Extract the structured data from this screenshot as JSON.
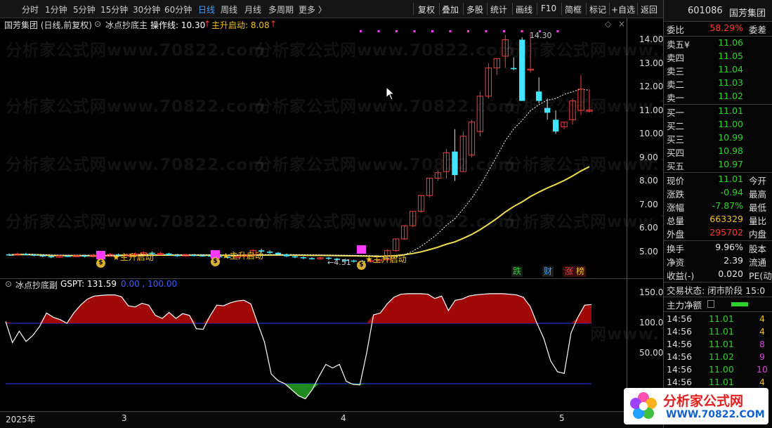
{
  "toolbar": {
    "periods": [
      "分时",
      "1分钟",
      "5分钟",
      "15分钟",
      "30分钟",
      "60分钟",
      "日线",
      "周线",
      "月线",
      "多周期",
      "更多 〉"
    ],
    "active_period": "日线",
    "tools": [
      "复权",
      "叠加",
      "多股",
      "统计",
      "画线",
      "F10",
      "简框",
      "标记",
      "+自选",
      "返回"
    ]
  },
  "main_chart": {
    "stock_title": "国芳集团 (日线,前复权)",
    "indicator_name": "冰点抄底主",
    "op_line_label": "操作线: 10.30",
    "op_line_arrow": "↑",
    "launch_label": "主升启动: 8.08",
    "launch_arrow": "↑",
    "signal_labels": [
      "主升启动",
      "主升启动",
      "主升启动"
    ],
    "high_label": "14.30",
    "low_label": "4.51",
    "y_ticks": [
      "14.00",
      "13.00",
      "12.00",
      "11.00",
      "10.00",
      "9.00",
      "8.00",
      "7.00",
      "6.00",
      "5.00"
    ],
    "money_bag_glyph": "$",
    "badges": [
      {
        "text": "跌",
        "color": "#2fd12f"
      },
      {
        "text": "财",
        "color": "#3fa0ff"
      },
      {
        "text": "涨",
        "color": "#ff3a3a"
      },
      {
        "text": "榜",
        "color": "#f0c020"
      }
    ],
    "colors": {
      "up": "#ff3a3a",
      "down": "#3fe6ff",
      "signal": "#ff3aff",
      "ma_slow": "#f0dd50",
      "ma_fast": "#ffffff"
    }
  },
  "chart_data": {
    "type": "candlestick",
    "y_axis": {
      "min": 4.0,
      "max": 15.0,
      "ticks": [
        14,
        13,
        12,
        11,
        10,
        9,
        8,
        7,
        6,
        5
      ]
    },
    "x_labels": [
      "2025年",
      "3",
      "4",
      "5"
    ],
    "candles": [
      [
        4.88,
        4.85,
        4.92,
        4.82
      ],
      [
        4.85,
        4.9,
        4.95,
        4.83
      ],
      [
        4.9,
        4.87,
        4.95,
        4.84
      ],
      [
        4.87,
        4.84,
        4.9,
        4.8
      ],
      [
        4.84,
        4.8,
        4.88,
        4.76
      ],
      [
        4.8,
        4.76,
        4.85,
        4.72
      ],
      [
        4.76,
        4.82,
        4.86,
        4.74
      ],
      [
        4.82,
        4.8,
        4.86,
        4.77
      ],
      [
        4.8,
        4.83,
        4.88,
        4.78
      ],
      [
        4.83,
        4.79,
        4.87,
        4.75
      ],
      [
        4.79,
        4.84,
        4.9,
        4.77
      ],
      [
        4.84,
        4.8,
        4.88,
        4.76
      ],
      [
        4.8,
        4.88,
        4.94,
        4.79
      ],
      [
        4.88,
        4.84,
        4.92,
        4.81
      ],
      [
        4.84,
        4.86,
        4.92,
        4.8
      ],
      [
        4.86,
        4.9,
        4.96,
        4.83
      ],
      [
        4.9,
        4.95,
        5.0,
        4.87
      ],
      [
        4.95,
        4.9,
        5.0,
        4.86
      ],
      [
        4.9,
        4.92,
        4.98,
        4.85
      ],
      [
        4.92,
        4.85,
        4.95,
        4.82
      ],
      [
        4.85,
        4.82,
        4.9,
        4.78
      ],
      [
        4.82,
        4.86,
        4.9,
        4.79
      ],
      [
        4.86,
        4.84,
        4.9,
        4.8
      ],
      [
        4.84,
        4.83,
        4.88,
        4.79
      ],
      [
        4.83,
        4.8,
        4.87,
        4.76
      ],
      [
        4.8,
        4.78,
        4.85,
        4.74
      ],
      [
        4.78,
        4.75,
        4.82,
        4.7
      ],
      [
        4.75,
        4.8,
        4.84,
        4.72
      ],
      [
        4.8,
        4.85,
        4.9,
        4.77
      ],
      [
        4.85,
        5.05,
        5.1,
        4.82
      ],
      [
        5.05,
        5.0,
        5.12,
        4.95
      ],
      [
        5.0,
        4.95,
        5.05,
        4.9
      ],
      [
        4.95,
        4.88,
        4.98,
        4.85
      ],
      [
        4.88,
        4.8,
        4.92,
        4.77
      ],
      [
        4.8,
        4.76,
        4.84,
        4.72
      ],
      [
        4.76,
        4.72,
        4.8,
        4.68
      ],
      [
        4.72,
        4.7,
        4.76,
        4.66
      ],
      [
        4.7,
        4.74,
        4.78,
        4.66
      ],
      [
        4.74,
        4.7,
        4.78,
        4.65
      ],
      [
        4.7,
        4.65,
        4.74,
        4.6
      ],
      [
        4.65,
        4.62,
        4.7,
        4.55
      ],
      [
        4.62,
        4.6,
        4.66,
        4.53
      ],
      [
        4.6,
        4.58,
        4.64,
        4.51
      ],
      [
        4.58,
        4.62,
        4.66,
        4.52
      ],
      [
        4.62,
        4.65,
        4.7,
        4.58
      ],
      [
        4.65,
        5.04,
        5.1,
        4.6
      ],
      [
        5.04,
        5.54,
        5.55,
        5.0
      ],
      [
        5.54,
        6.1,
        6.1,
        5.5
      ],
      [
        6.1,
        6.71,
        6.71,
        6.05
      ],
      [
        6.71,
        7.38,
        7.38,
        6.65
      ],
      [
        7.38,
        8.12,
        8.12,
        7.3
      ],
      [
        8.12,
        8.35,
        8.45,
        8.0
      ],
      [
        8.4,
        9.2,
        9.35,
        8.1
      ],
      [
        9.25,
        8.25,
        10.2,
        8.0
      ],
      [
        8.4,
        9.9,
        10.1,
        8.4
      ],
      [
        9.1,
        10.5,
        10.6,
        9.0
      ],
      [
        10.1,
        11.6,
        11.8,
        9.9
      ],
      [
        11.6,
        12.8,
        13.0,
        11.5
      ],
      [
        12.8,
        13.2,
        13.2,
        12.5
      ],
      [
        13.3,
        14.0,
        14.2,
        12.8
      ],
      [
        12.8,
        12.75,
        13.25,
        12.7
      ],
      [
        14.0,
        11.4,
        14.1,
        11.4
      ],
      [
        12.75,
        12.75,
        14.3,
        12.6
      ],
      [
        11.8,
        11.4,
        12.4,
        11.3
      ],
      [
        11.1,
        10.9,
        11.5,
        10.6
      ],
      [
        10.6,
        10.1,
        11.0,
        10.0
      ],
      [
        10.3,
        10.5,
        10.5,
        10.2
      ],
      [
        10.6,
        11.4,
        11.5,
        10.4
      ],
      [
        11.0,
        11.9,
        12.5,
        10.8
      ],
      [
        11.0,
        11.01,
        11.9,
        10.9
      ]
    ],
    "ma_fast": [],
    "ma_slow": []
  },
  "sub_chart": {
    "name": "冰点抄底副",
    "value_label": "GSPT: 131.59",
    "range_label": "0.00 , 100.00",
    "y_ticks": [
      "150.0",
      "100.0",
      "50.00"
    ]
  },
  "gspt_data": {
    "type": "area",
    "y_axis": {
      "min": -25,
      "max": 165
    },
    "values": [
      103,
      68,
      87,
      70,
      80,
      95,
      117,
      110,
      106,
      100,
      117,
      130,
      140,
      145,
      146,
      147,
      147,
      144,
      129,
      127,
      133,
      130,
      113,
      108,
      118,
      108,
      116,
      113,
      91,
      90,
      112,
      130,
      129,
      134,
      137,
      138,
      132,
      100,
      69,
      16,
      5,
      0,
      -10,
      -20,
      -25,
      -10,
      12,
      32,
      26,
      32,
      4,
      -1,
      -2,
      51,
      114,
      117,
      132,
      143,
      148,
      149,
      149,
      149,
      148,
      141,
      145,
      121,
      138,
      140,
      145,
      147,
      148,
      149,
      149,
      149,
      148,
      147,
      143,
      128,
      100,
      75,
      38,
      20,
      17,
      84,
      110,
      130,
      131
    ]
  },
  "right_panel": {
    "stock_code": "601086",
    "stock_name": "国芳集团",
    "wei_bi": {
      "label": "委比",
      "value": "58.29%",
      "extra": "委差"
    },
    "asks": [
      {
        "label": "卖五",
        "flag": "¥",
        "price": "11.06"
      },
      {
        "label": "卖四",
        "flag": "",
        "price": "11.05"
      },
      {
        "label": "卖三",
        "flag": "",
        "price": "11.04"
      },
      {
        "label": "卖二",
        "flag": "",
        "price": "11.03"
      },
      {
        "label": "卖一",
        "flag": "",
        "price": "11.02"
      }
    ],
    "bids": [
      {
        "label": "买一",
        "price": "11.01"
      },
      {
        "label": "买二",
        "price": "11.00"
      },
      {
        "label": "买三",
        "price": "10.99"
      },
      {
        "label": "买四",
        "price": "10.98"
      },
      {
        "label": "买五",
        "price": "10.97"
      }
    ],
    "stats": [
      {
        "label": "现价",
        "value": "11.01",
        "color": "green",
        "extra": "今开"
      },
      {
        "label": "涨跌",
        "value": "-0.94",
        "color": "green",
        "extra": "最高"
      },
      {
        "label": "涨幅",
        "value": "-7.87%",
        "color": "green",
        "extra": "最低"
      },
      {
        "label": "总量",
        "value": "663329",
        "color": "yellow",
        "extra": "量比"
      },
      {
        "label": "外盘",
        "value": "295702",
        "color": "red",
        "extra": "内盘"
      }
    ],
    "stats2": [
      {
        "label": "换手",
        "value": "9.96%",
        "color": "white",
        "extra": "股本"
      },
      {
        "label": "净资",
        "value": "2.39",
        "color": "white",
        "extra": "流通"
      },
      {
        "label": "收益(-)",
        "value": "0.020",
        "color": "white",
        "extra": "PE(动"
      }
    ],
    "trade_status": "交易状态: 闭市阶段 15:0",
    "main_net": "主力净额",
    "ticks": [
      {
        "time": "14:56",
        "price": "11.01",
        "vol": "4",
        "color": "yellow"
      },
      {
        "time": "14:56",
        "price": "11.01",
        "vol": "4",
        "color": "yellow"
      },
      {
        "time": "14:56",
        "price": "11.01",
        "vol": "8",
        "color": "magenta"
      },
      {
        "time": "14:56",
        "price": "11.02",
        "vol": "9",
        "color": "magenta"
      },
      {
        "time": "14:56",
        "price": "11.00",
        "vol": "10",
        "color": "magenta"
      },
      {
        "time": "14:56",
        "price": "11.01",
        "vol": "4",
        "color": "yellow"
      }
    ]
  },
  "watermark": {
    "text_left": "分析家公式网",
    "text_url": "www.70822.com"
  },
  "logo": {
    "title": "分析家公式网",
    "url": "WWW.70822.COM"
  }
}
